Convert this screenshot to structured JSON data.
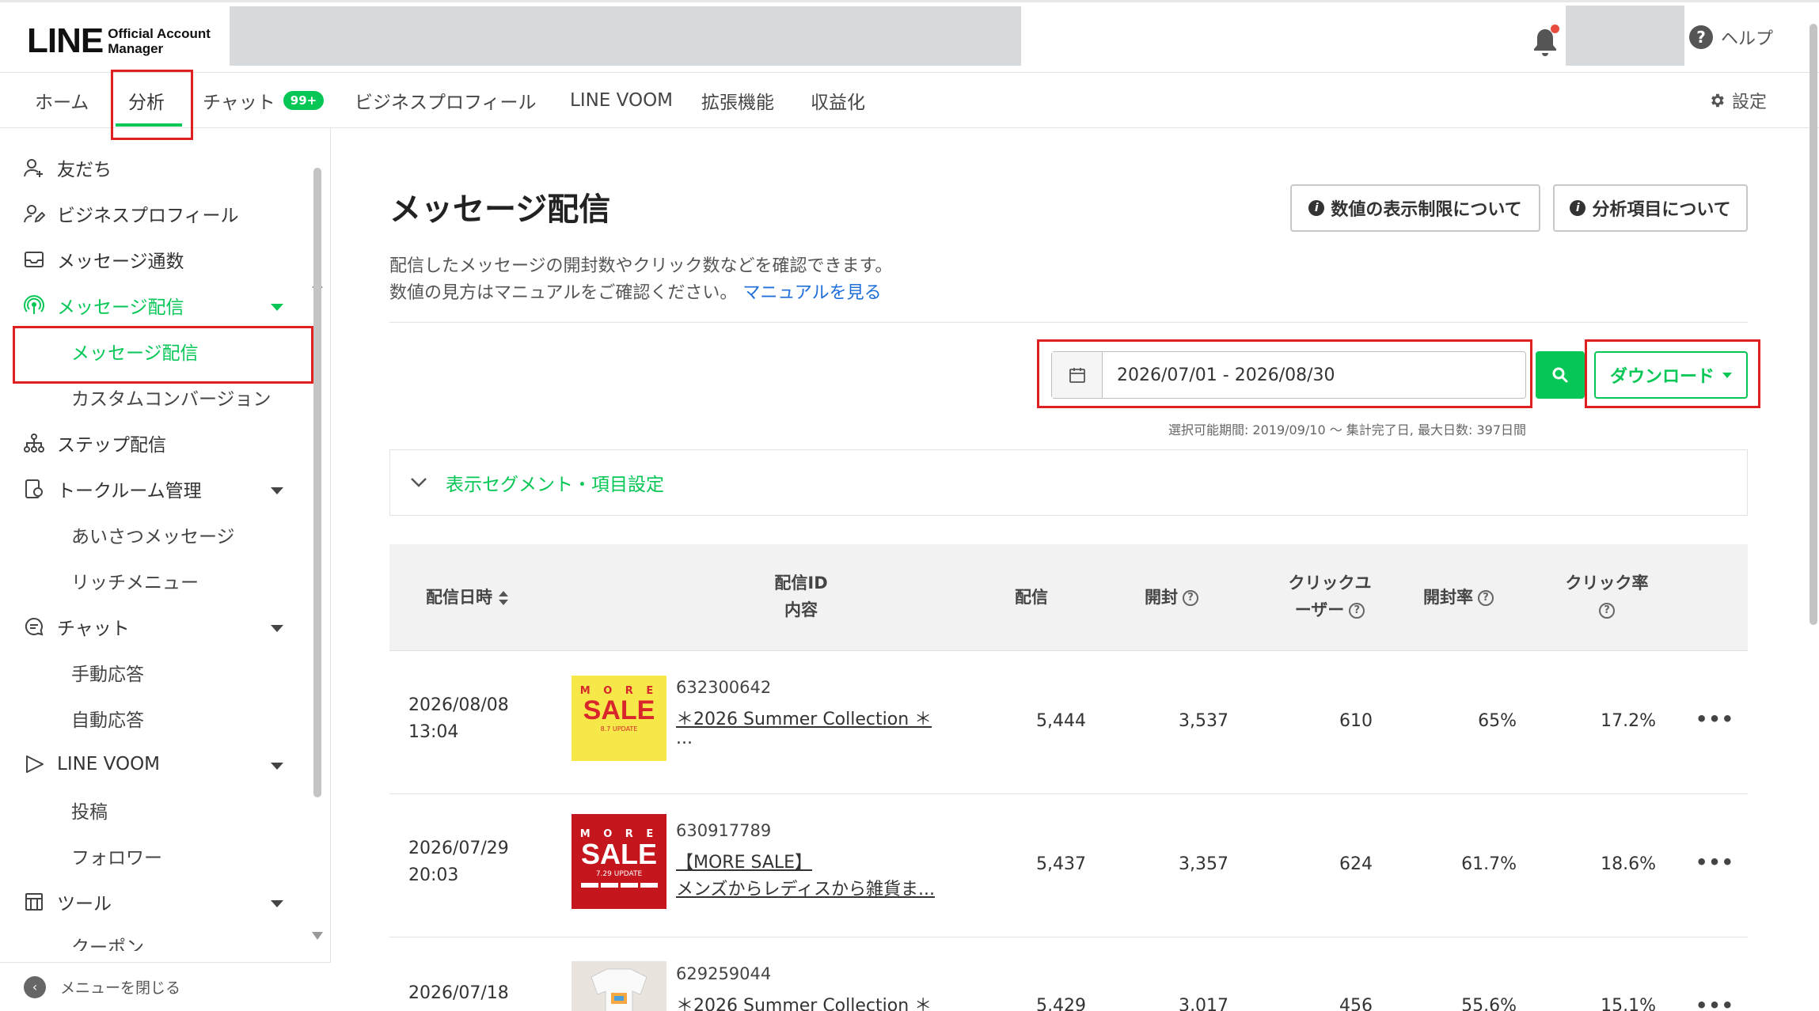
{
  "header": {
    "logo_big": "LINE",
    "logo_small_line1": "Official Account",
    "logo_small_line2": "Manager",
    "help_label": "ヘルプ",
    "help_icon": "?"
  },
  "nav": {
    "items": [
      {
        "label": "ホーム"
      },
      {
        "label": "分析"
      },
      {
        "label": "チャット"
      },
      {
        "label": "ビジネスプロフィール"
      },
      {
        "label": "LINE VOOM"
      },
      {
        "label": "拡張機能"
      },
      {
        "label": "収益化"
      }
    ],
    "chat_badge": "99+",
    "settings_label": "設定"
  },
  "sidebar": {
    "items": [
      {
        "label": "友だち",
        "icon": "friend-add-icon"
      },
      {
        "label": "ビジネスプロフィール",
        "icon": "profile-icon"
      },
      {
        "label": "メッセージ通数",
        "icon": "inbox-icon"
      },
      {
        "label": "メッセージ配信",
        "icon": "broadcast-icon"
      },
      {
        "label": "メッセージ配信",
        "icon": ""
      },
      {
        "label": "カスタムコンバージョン",
        "icon": ""
      },
      {
        "label": "ステップ配信",
        "icon": "step-icon"
      },
      {
        "label": "トークルーム管理",
        "icon": "chatroom-icon"
      },
      {
        "label": "あいさつメッセージ",
        "icon": ""
      },
      {
        "label": "リッチメニュー",
        "icon": ""
      },
      {
        "label": "チャット",
        "icon": "chat-icon"
      },
      {
        "label": "手動応答",
        "icon": ""
      },
      {
        "label": "自動応答",
        "icon": ""
      },
      {
        "label": "LINE VOOM",
        "icon": "voom-icon"
      },
      {
        "label": "投稿",
        "icon": ""
      },
      {
        "label": "フォロワー",
        "icon": ""
      },
      {
        "label": "ツール",
        "icon": "tool-icon"
      },
      {
        "label": "クーポン",
        "icon": ""
      }
    ],
    "close_menu_label": "メニューを閉じる"
  },
  "main": {
    "title": "メッセージ配信",
    "btn_display_limit": "数値の表示制限について",
    "btn_analysis_items": "分析項目について",
    "desc_line1": "配信したメッセージの開封数やクリック数などを確認できます。",
    "desc_line2": "数値の見方はマニュアルをご確認ください。",
    "manual_link": "マニュアルを見る",
    "date_range": "2026/07/01 - 2026/08/30",
    "download_label": "ダウンロード",
    "period_note": "選択可能期間: 2019/09/10 〜 集計完了日, 最大日数: 397日間",
    "segment_label": "表示セグメント・項目設定"
  },
  "table": {
    "headers": {
      "date": "配信日時",
      "id_line1": "配信ID",
      "id_line2": "内容",
      "sent": "配信",
      "opened": "開封",
      "click_line1": "クリックユ",
      "click_line2": "ーザー",
      "open_rate": "開封率",
      "click_rate": "クリック率"
    },
    "rows": [
      {
        "date": "2026/08/08",
        "time": "13:04",
        "id": "632300642",
        "title": "＊2026 Summer Collection ＊",
        "sub": "...",
        "thumb_top": "M O R E",
        "thumb_main": "SALE",
        "thumb_bottom": "8.7 UPDATE",
        "thumb_bg": "#f7e84a",
        "thumb_fg": "#d9262c",
        "sent": "5,444",
        "opened": "3,537",
        "clicks": "610",
        "open_rate": "65%",
        "click_rate": "17.2%"
      },
      {
        "date": "2026/07/29",
        "time": "20:03",
        "id": "630917789",
        "title": "【MORE SALE】",
        "sub": "メンズからレディスから雑貨ま...",
        "thumb_top": "M O R E",
        "thumb_main": "SALE",
        "thumb_bottom": "7.29 UPDATE",
        "thumb_bg": "#c4161c",
        "thumb_fg": "#ffffff",
        "sent": "5,437",
        "opened": "3,357",
        "clicks": "624",
        "open_rate": "61.7%",
        "click_rate": "18.6%"
      },
      {
        "date": "2026/07/18",
        "time": "",
        "id": "629259044",
        "title": "＊2026 Summer Collection ＊",
        "sub": "",
        "thumb_top": "",
        "thumb_main": "",
        "thumb_bottom": "",
        "thumb_bg": "#e9e4de",
        "thumb_fg": "#333333",
        "sent": "5,429",
        "opened": "3,017",
        "clicks": "456",
        "open_rate": "55.6%",
        "click_rate": "15.1%"
      }
    ],
    "more_label": "•••"
  },
  "colors": {
    "accent_green": "#06c755",
    "highlight_red": "#e02020",
    "link_blue": "#1e6fd9"
  }
}
